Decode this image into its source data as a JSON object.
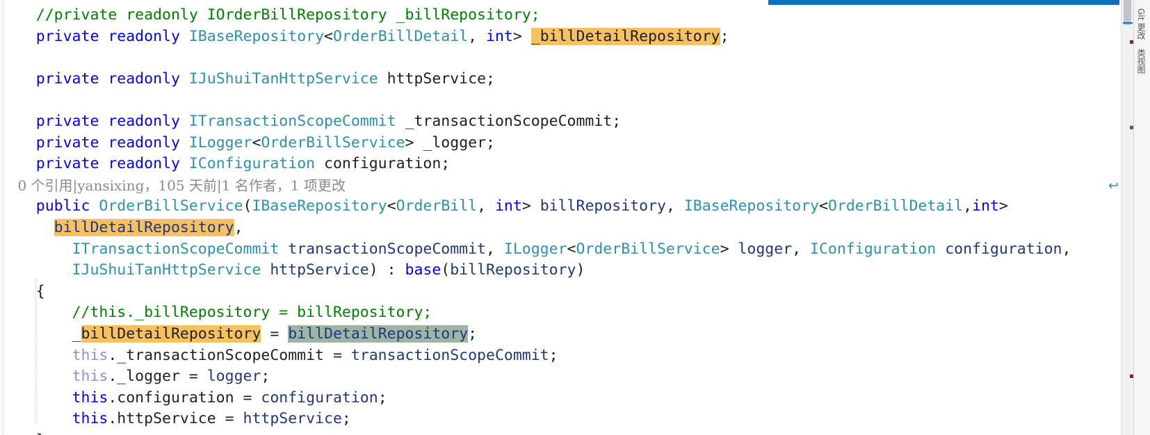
{
  "editor": {
    "lines": [
      [
        {
          "c": "cm",
          "t": "//private readonly IOrderBillRepository _billRepository;"
        }
      ],
      [
        {
          "c": "kw",
          "t": "private"
        },
        {
          "c": "pl",
          "t": " "
        },
        {
          "c": "kw",
          "t": "readonly"
        },
        {
          "c": "pl",
          "t": " "
        },
        {
          "c": "ty",
          "t": "IBaseRepository"
        },
        {
          "c": "pl",
          "t": "<"
        },
        {
          "c": "ty",
          "t": "OrderBillDetail"
        },
        {
          "c": "pl",
          "t": ", "
        },
        {
          "c": "kw",
          "t": "int"
        },
        {
          "c": "pl",
          "t": "> "
        },
        {
          "c": "pl hl",
          "t": "_billDetailRepository"
        },
        {
          "c": "pl",
          "t": ";"
        }
      ],
      [],
      [
        {
          "c": "kw",
          "t": "private"
        },
        {
          "c": "pl",
          "t": " "
        },
        {
          "c": "kw",
          "t": "readonly"
        },
        {
          "c": "pl",
          "t": " "
        },
        {
          "c": "ty",
          "t": "IJuShuiTanHttpService"
        },
        {
          "c": "pl",
          "t": " httpService;"
        }
      ],
      [],
      [
        {
          "c": "kw",
          "t": "private"
        },
        {
          "c": "pl",
          "t": " "
        },
        {
          "c": "kw",
          "t": "readonly"
        },
        {
          "c": "pl",
          "t": " "
        },
        {
          "c": "ty",
          "t": "ITransactionScopeCommit"
        },
        {
          "c": "pl",
          "t": " _transactionScopeCommit;"
        }
      ],
      [
        {
          "c": "kw",
          "t": "private"
        },
        {
          "c": "pl",
          "t": " "
        },
        {
          "c": "kw",
          "t": "readonly"
        },
        {
          "c": "pl",
          "t": " "
        },
        {
          "c": "ty",
          "t": "ILogger"
        },
        {
          "c": "pl",
          "t": "<"
        },
        {
          "c": "ty",
          "t": "OrderBillService"
        },
        {
          "c": "pl",
          "t": "> _logger;"
        }
      ],
      [
        {
          "c": "kw",
          "t": "private"
        },
        {
          "c": "pl",
          "t": " "
        },
        {
          "c": "kw",
          "t": "readonly"
        },
        {
          "c": "pl",
          "t": " "
        },
        {
          "c": "ty",
          "t": "IConfiguration"
        },
        {
          "c": "pl",
          "t": " configuration;"
        }
      ],
      [
        {
          "c": "lens",
          "t": "0 个引用|yansixing，105 天前|1 名作者，1 项更改"
        }
      ],
      [
        {
          "c": "kw",
          "t": "public"
        },
        {
          "c": "pl",
          "t": " "
        },
        {
          "c": "ty",
          "t": "OrderBillService"
        },
        {
          "c": "pl",
          "t": "("
        },
        {
          "c": "ty",
          "t": "IBaseRepository"
        },
        {
          "c": "pl",
          "t": "<"
        },
        {
          "c": "ty",
          "t": "OrderBill"
        },
        {
          "c": "pl",
          "t": ", "
        },
        {
          "c": "kw",
          "t": "int"
        },
        {
          "c": "pl",
          "t": "> "
        },
        {
          "c": "id",
          "t": "billRepository"
        },
        {
          "c": "pl",
          "t": ", "
        },
        {
          "c": "ty",
          "t": "IBaseRepository"
        },
        {
          "c": "pl",
          "t": "<"
        },
        {
          "c": "ty",
          "t": "OrderBillDetail"
        },
        {
          "c": "pl",
          "t": ","
        },
        {
          "c": "kw",
          "t": "int"
        },
        {
          "c": "pl",
          "t": ">"
        }
      ],
      [
        {
          "c": "pl",
          "t": "  "
        },
        {
          "c": "id hl",
          "t": "billDetailRepository"
        },
        {
          "c": "pl",
          "t": ","
        }
      ],
      [
        {
          "c": "pl",
          "t": "    "
        },
        {
          "c": "ty",
          "t": "ITransactionScopeCommit"
        },
        {
          "c": "pl",
          "t": " "
        },
        {
          "c": "id",
          "t": "transactionScopeCommit"
        },
        {
          "c": "pl",
          "t": ", "
        },
        {
          "c": "ty",
          "t": "ILogger"
        },
        {
          "c": "pl",
          "t": "<"
        },
        {
          "c": "ty",
          "t": "OrderBillService"
        },
        {
          "c": "pl",
          "t": "> "
        },
        {
          "c": "id",
          "t": "logger"
        },
        {
          "c": "pl",
          "t": ", "
        },
        {
          "c": "ty",
          "t": "IConfiguration"
        },
        {
          "c": "pl",
          "t": " "
        },
        {
          "c": "id",
          "t": "configuration"
        },
        {
          "c": "pl",
          "t": ","
        }
      ],
      [
        {
          "c": "pl",
          "t": "    "
        },
        {
          "c": "ty",
          "t": "IJuShuiTanHttpService"
        },
        {
          "c": "pl",
          "t": " "
        },
        {
          "c": "id",
          "t": "httpService"
        },
        {
          "c": "pl",
          "t": ") : "
        },
        {
          "c": "kw",
          "t": "base"
        },
        {
          "c": "pl",
          "t": "("
        },
        {
          "c": "id",
          "t": "billRepository"
        },
        {
          "c": "pl",
          "t": ")"
        }
      ],
      [
        {
          "c": "pl",
          "t": "{"
        }
      ],
      [
        {
          "c": "pl",
          "t": "    "
        },
        {
          "c": "cm",
          "t": "//this._billRepository = billRepository;"
        }
      ],
      [
        {
          "c": "pl",
          "t": "    _"
        },
        {
          "c": "pl hl",
          "t": "billDetailRepository"
        },
        {
          "c": "pl",
          "t": " = "
        },
        {
          "c": "id hl2",
          "t": "billDetailRepository"
        },
        {
          "c": "pl",
          "t": ";"
        }
      ],
      [
        {
          "c": "pl",
          "t": "    "
        },
        {
          "c": "th",
          "t": "this"
        },
        {
          "c": "pl",
          "t": "._transactionScopeCommit = "
        },
        {
          "c": "id",
          "t": "transactionScopeCommit"
        },
        {
          "c": "pl",
          "t": ";"
        }
      ],
      [
        {
          "c": "pl",
          "t": "    "
        },
        {
          "c": "th",
          "t": "this"
        },
        {
          "c": "pl",
          "t": "._logger = "
        },
        {
          "c": "id",
          "t": "logger"
        },
        {
          "c": "pl",
          "t": ";"
        }
      ],
      [
        {
          "c": "pl",
          "t": "    "
        },
        {
          "c": "kw",
          "t": "this"
        },
        {
          "c": "pl",
          "t": ".configuration = "
        },
        {
          "c": "id",
          "t": "configuration"
        },
        {
          "c": "pl",
          "t": ";"
        }
      ],
      [
        {
          "c": "pl",
          "t": "    "
        },
        {
          "c": "kw",
          "t": "this"
        },
        {
          "c": "pl",
          "t": ".httpService = "
        },
        {
          "c": "id",
          "t": "httpService"
        },
        {
          "c": "pl",
          "t": ";"
        }
      ],
      [
        {
          "c": "pl",
          "t": "}"
        }
      ]
    ]
  },
  "icons": {
    "word_wrap": "↩"
  },
  "side_panel": {
    "tabs": [
      "Git 更改",
      "类视图"
    ]
  },
  "scroll_marks": [
    {
      "color": "#9b1c1c",
      "kind": "error-mark"
    },
    {
      "color": "#1f8a1f",
      "kind": "change-mark"
    },
    {
      "color": "#9b1c1c",
      "kind": "error-mark"
    }
  ],
  "colors": {
    "keyword": "#0000ff",
    "type": "#2b91af",
    "identifier": "#1f377f",
    "comment": "#008000",
    "highlight": "#f7c162",
    "selection": "#9fb4a3",
    "accent": "#0e70c0"
  }
}
